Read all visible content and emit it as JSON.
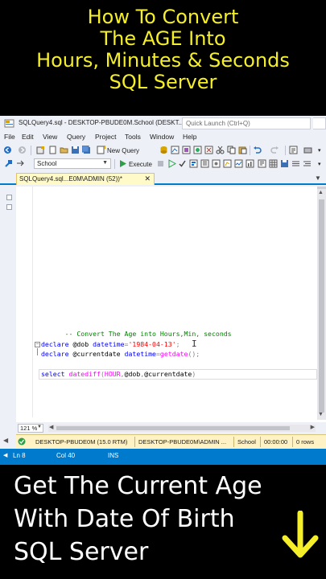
{
  "banner_top": {
    "lines": [
      "How To Convert",
      "The AGE Into",
      "Hours, Minutes & Seconds",
      "SQL Server"
    ],
    "color": "#f5ef2a"
  },
  "window": {
    "title": "SQLQuery4.sql - DESKTOP-PBUDE0M.School (DESKT...",
    "quick_launch_placeholder": "Quick Launch (Ctrl+Q)",
    "app_icon": "ssms-app-icon"
  },
  "menu": {
    "items": [
      "File",
      "Edit",
      "View",
      "Query",
      "Project",
      "Tools",
      "Window",
      "Help"
    ]
  },
  "toolbar": {
    "new_query_label": "New Query",
    "execute_label": "Execute",
    "database_value": "School"
  },
  "tab": {
    "label": "SQLQuery4.sql...E0M\\ADMIN (52))*",
    "close_glyph": "✕"
  },
  "code": {
    "comment": "-- Convert The Age into Hours,Min, seconds",
    "line1": {
      "kw": "declare",
      "var": "@dob",
      "type": "datetime",
      "op": "=",
      "str": "'1984-04-13'",
      "end": ";"
    },
    "line2": {
      "kw": "declare",
      "var": "@currentdate",
      "type": "datetime",
      "op": "=",
      "func": "getdate",
      "parens": "()",
      "end": ";"
    },
    "line3": {
      "kw": "select",
      "func": "datediff",
      "open": "(",
      "arg1": "HOUR",
      "comma1": ",",
      "arg2": "@dob",
      "comma2": ",",
      "arg3": "@currentdate",
      "close": ")"
    }
  },
  "editor": {
    "zoom": "121 %"
  },
  "connection_status": {
    "server": "DESKTOP-PBUDE0M (15.0 RTM)",
    "user": "DESKTOP-PBUDE0M\\ADMIN ...",
    "database": "School",
    "elapsed": "00:00:00",
    "rows": "0 rows"
  },
  "statusbar": {
    "line": "Ln 8",
    "col": "Col 40",
    "mode": "INS",
    "color": "#007acc"
  },
  "banner_bottom": {
    "lines": [
      "Get The Current Age",
      "With Date Of Birth",
      "SQL Server"
    ],
    "arrow_icon": "down-arrow-icon",
    "arrow_color": "#f5ef2a"
  }
}
